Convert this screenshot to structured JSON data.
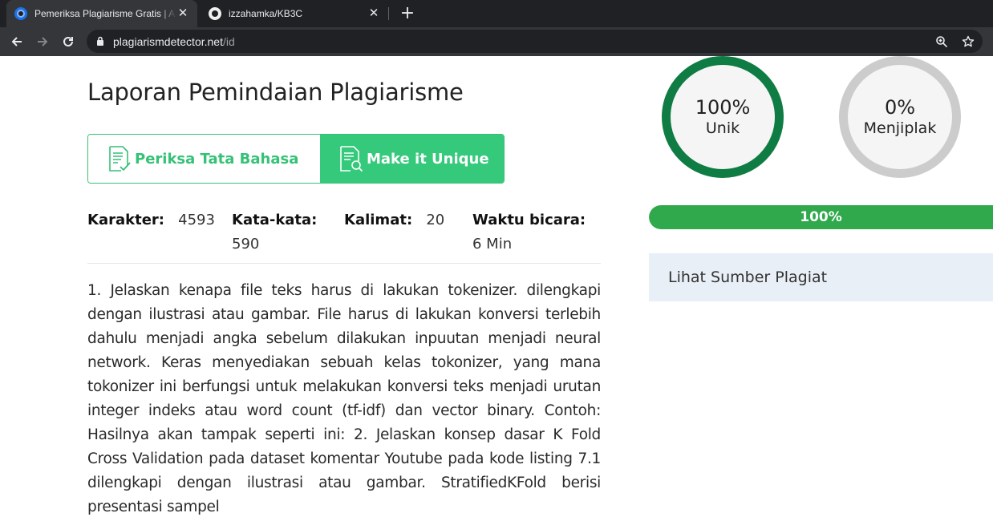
{
  "browser": {
    "tabs": [
      {
        "title": "Pemeriksa Plagiarisme Gratis | Akurat",
        "active": true
      },
      {
        "title": "izzahamka/KB3C",
        "active": false
      }
    ],
    "new_tab": "+",
    "close_glyph": "✕",
    "url_host": "plagiarismdetector.net",
    "url_path": "/id"
  },
  "page": {
    "title": "Laporan Pemindaian Plagiarisme",
    "buttons": {
      "grammar": "Periksa Tata Bahasa",
      "unique": "Make it Unique"
    },
    "stats": {
      "characters_label": "Karakter:",
      "characters_value": "4593",
      "words_label": "Kata-kata:",
      "words_value": "590",
      "sentences_label": "Kalimat:",
      "sentences_value": "20",
      "speak_label": "Waktu bicara:",
      "speak_value": "6 Min"
    },
    "report_text": "1. Jelaskan kenapa file teks harus di lakukan tokenizer. dilengkapi dengan ilustrasi atau gambar. File harus di lakukan konversi terlebih dahulu menjadi angka sebelum dilakukan inpuutan menjadi neural network. Keras menyediakan sebuah kelas tokonizer, yang mana tokonizer ini berfungsi untuk melakukan konversi teks menjadi urutan integer indeks atau word count (tf-idf) dan vector binary. Contoh: Hasilnya akan tampak seperti ini: 2. Jelaskan konsep dasar K Fold Cross Validation pada dataset komentar Youtube pada kode listing 7.1 dilengkapi dengan ilustrasi atau gambar. StratifiedKFold berisi presentasi sampel"
  },
  "results": {
    "unique_pct": "100%",
    "unique_label": "Unik",
    "plagiarized_pct": "0%",
    "plagiarized_label": "Menjiplak",
    "progress_value": 1.0,
    "progress_label": "100%",
    "sources_label": "Lihat Sumber Plagiat"
  },
  "colors": {
    "accent_green": "#35c176",
    "unique_ring": "#0f7c43",
    "plag_ring": "#cccccc",
    "progress": "#2fa94b"
  },
  "icons": [
    "back-icon",
    "forward-icon",
    "reload-icon",
    "lock-icon",
    "zoom-icon",
    "star-icon",
    "github-icon",
    "grammar-doc-icon",
    "unique-doc-icon"
  ]
}
